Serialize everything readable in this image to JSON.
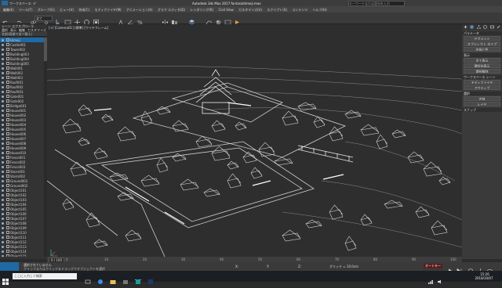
{
  "app": {
    "title": "Autodesk 3ds Max 2017   fantasiahimeji.max",
    "tab_title": "ワークスペース: デ",
    "search_placeholder": "キーワードまたは語句を入力"
  },
  "menubar": {
    "items": [
      "編集(E)",
      "ツール(T)",
      "グループ(G)",
      "ビュー(V)",
      "作成(C)",
      "モディファイヤ(M)",
      "アニメーション(A)",
      "グラフ エディタ(D)",
      "レンダリング(R)",
      "Civil View",
      "カスタマイズ(U)",
      "スクリプト(S)",
      "コンテンツ",
      "ヘルプ(H)"
    ]
  },
  "toolbar": {
    "selection_filter": "全て"
  },
  "scene_explorer": {
    "title": "シーン エクスプローラ",
    "tabs": [
      "選択",
      "表示",
      "編集",
      "カスタマイズ"
    ],
    "header": "名前(昇順で並べ替え)",
    "items": [
      "Himeji",
      "Castle001",
      "Tower002",
      "Building003",
      "Building004",
      "Building005",
      "Wall001",
      "Wall002",
      "Wall003",
      "Roof001",
      "Roof002",
      "Roof003",
      "Gate001",
      "Gate002",
      "Bridge001",
      "House001",
      "House002",
      "House003",
      "House004",
      "House005",
      "House006",
      "House007",
      "House008",
      "House009",
      "House010",
      "Fence001",
      "Fence002",
      "Fence003",
      "Stairs001",
      "Stairs002",
      "Ground001",
      "Ground002",
      "Object101",
      "Object102",
      "Object103",
      "Object104",
      "Object105",
      "Object106",
      "Object107",
      "Object108",
      "Object109",
      "Object110",
      "Object111",
      "Object112",
      "Object113",
      "Object114",
      "Object115",
      "Object116",
      "Object117"
    ]
  },
  "viewport": {
    "label": "[+] [Camera01] [標準] [ワイヤフレーム]"
  },
  "command_panel": {
    "sections": [
      {
        "title": "パラメータ",
        "rows": [
          "セグメント",
          "オブジェクト タイプ",
          "名前と色"
        ]
      },
      {
        "title": "表示",
        "rows": [
          "全て表示",
          "選択非表示",
          "選択解除"
        ]
      },
      {
        "title": "ワークスペース シーン",
        "rows": [
          "モディファイヤ",
          "アクティブ"
        ]
      },
      {
        "title": "選択",
        "rows": [
          "名前",
          "レイヤ"
        ]
      },
      {
        "title": "スナップ",
        "rows": []
      }
    ]
  },
  "timeline": {
    "frame": "0 / 100",
    "ticks": [
      "0",
      "10",
      "20",
      "30",
      "40",
      "50",
      "60",
      "70",
      "80",
      "90",
      "100"
    ]
  },
  "statusbar": {
    "selection": "選択されていません",
    "hint": "クリックまたはクリック＆ドラッグでオブジェクトを選択",
    "x_label": "X:",
    "y_label": "Y:",
    "z_label": "Z:",
    "grid": "グリッド = 10.0cm",
    "autokey": "オートキー"
  },
  "taskbar": {
    "search_text": "ここに入力して検索",
    "time": "15:26",
    "date": "2018/10/07"
  },
  "colors": {
    "accent": "#1f6aa5",
    "wire": "#d9d9d9",
    "viewport_bg": "#2e2e2e"
  }
}
